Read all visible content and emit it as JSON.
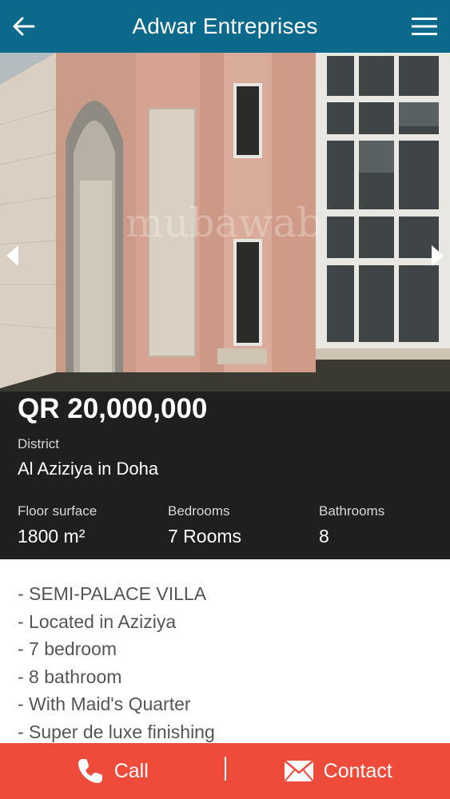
{
  "header": {
    "title": "Adwar Entreprises",
    "back_icon": "arrow-left-icon",
    "menu_icon": "hamburger-menu-icon"
  },
  "gallery": {
    "prev_icon": "chevron-left-icon",
    "next_icon": "chevron-right-icon",
    "watermark": "mubawab"
  },
  "listing": {
    "price": "QR 20,000,000",
    "district_label": "District",
    "district_value": "Al Aziziya in Doha",
    "stats": [
      {
        "label": "Floor surface",
        "value": "1800 m²"
      },
      {
        "label": "Bedrooms",
        "value": "7 Rooms"
      },
      {
        "label": "Bathrooms",
        "value": "8"
      }
    ]
  },
  "description": {
    "lines": [
      "- SEMI-PALACE VILLA",
      "- Located in Aziziya",
      "- 7 bedroom",
      "- 8 bathroom",
      "- With Maid's Quarter",
      "- Super de luxe finishing"
    ]
  },
  "actions": {
    "call_label": "Call",
    "call_icon": "phone-icon",
    "contact_label": "Contact",
    "contact_icon": "envelope-icon"
  },
  "colors": {
    "appbar": "#0b6a8c",
    "info_panel": "#1f1f1f",
    "action_bar": "#ef4b3b"
  }
}
